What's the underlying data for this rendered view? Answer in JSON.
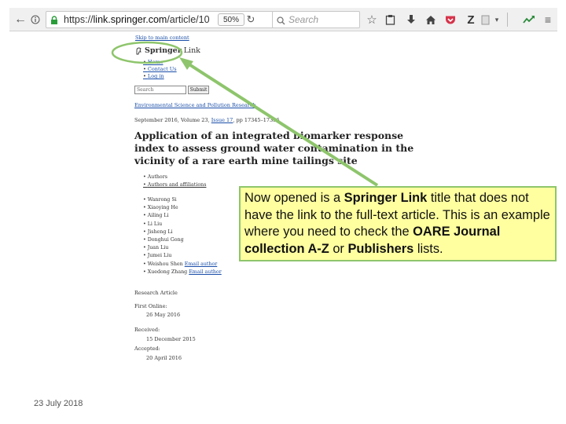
{
  "browser": {
    "url_scheme": "https://",
    "url_host": "link.springer.com",
    "url_path": "/article/10",
    "zoom_level": "50%",
    "search_placeholder": "Search"
  },
  "page": {
    "skip_link": "Skip to main content",
    "logo_brand": "Springer",
    "logo_suffix": "Link",
    "nav": [
      "Home",
      "Contact Us",
      "Log in"
    ],
    "search_placeholder": "Search",
    "search_button": "Submit",
    "journal": "Environmental Science and Pollution Research",
    "issue_prefix": "September 2016, Volume 23, ",
    "issue_link": "Issue 17",
    "issue_suffix": ", pp 17345–17356",
    "article_title": "Application of an integrated biomarker response index to assess ground water contamination in the vicinity of a rare earth mine tailings site",
    "authors_section": [
      "Authors",
      "Authors and affiliations"
    ],
    "authors": [
      {
        "name": "Wanrong Si",
        "email": ""
      },
      {
        "name": "Xiaoying He",
        "email": ""
      },
      {
        "name": "Ailing Li",
        "email": ""
      },
      {
        "name": "Li Liu",
        "email": ""
      },
      {
        "name": "Jisheng Li",
        "email": ""
      },
      {
        "name": "Donghui Gong",
        "email": ""
      },
      {
        "name": "Juan Liu",
        "email": ""
      },
      {
        "name": "Jumei Liu",
        "email": ""
      },
      {
        "name": "Weishou Shen",
        "email": "Email author"
      },
      {
        "name": "Xuedong Zhang",
        "email": "Email author"
      }
    ],
    "article_type": "Research Article",
    "first_online_label": "First Online:",
    "first_online_value": "26 May 2016",
    "received_label": "Received:",
    "received_value": "15 December 2015",
    "accepted_label": "Accepted:",
    "accepted_value": "20 April 2016"
  },
  "callout": {
    "part1": "Now opened is a ",
    "bold1": "Springer Link",
    "part2": " title that does not have the link to the full-text article.  This is an example where you need to check the ",
    "bold2": "OARE Journal collection A-Z",
    "part3": " or ",
    "bold3": "Publishers",
    "part4": " lists."
  },
  "footer": {
    "date": "23 July 2018"
  },
  "colors": {
    "callout_bg": "#ffffa0",
    "callout_border": "#8ec56c",
    "arrow": "#8ec56c",
    "link": "#1a4ea8"
  },
  "icons": [
    "back-arrow-icon",
    "info-icon",
    "lock-icon",
    "reload-icon",
    "search-icon",
    "bookmark-star-icon",
    "clipboard-icon",
    "download-icon",
    "home-icon",
    "pocket-icon",
    "zotero-icon",
    "menu-icon",
    "extension-icon"
  ]
}
